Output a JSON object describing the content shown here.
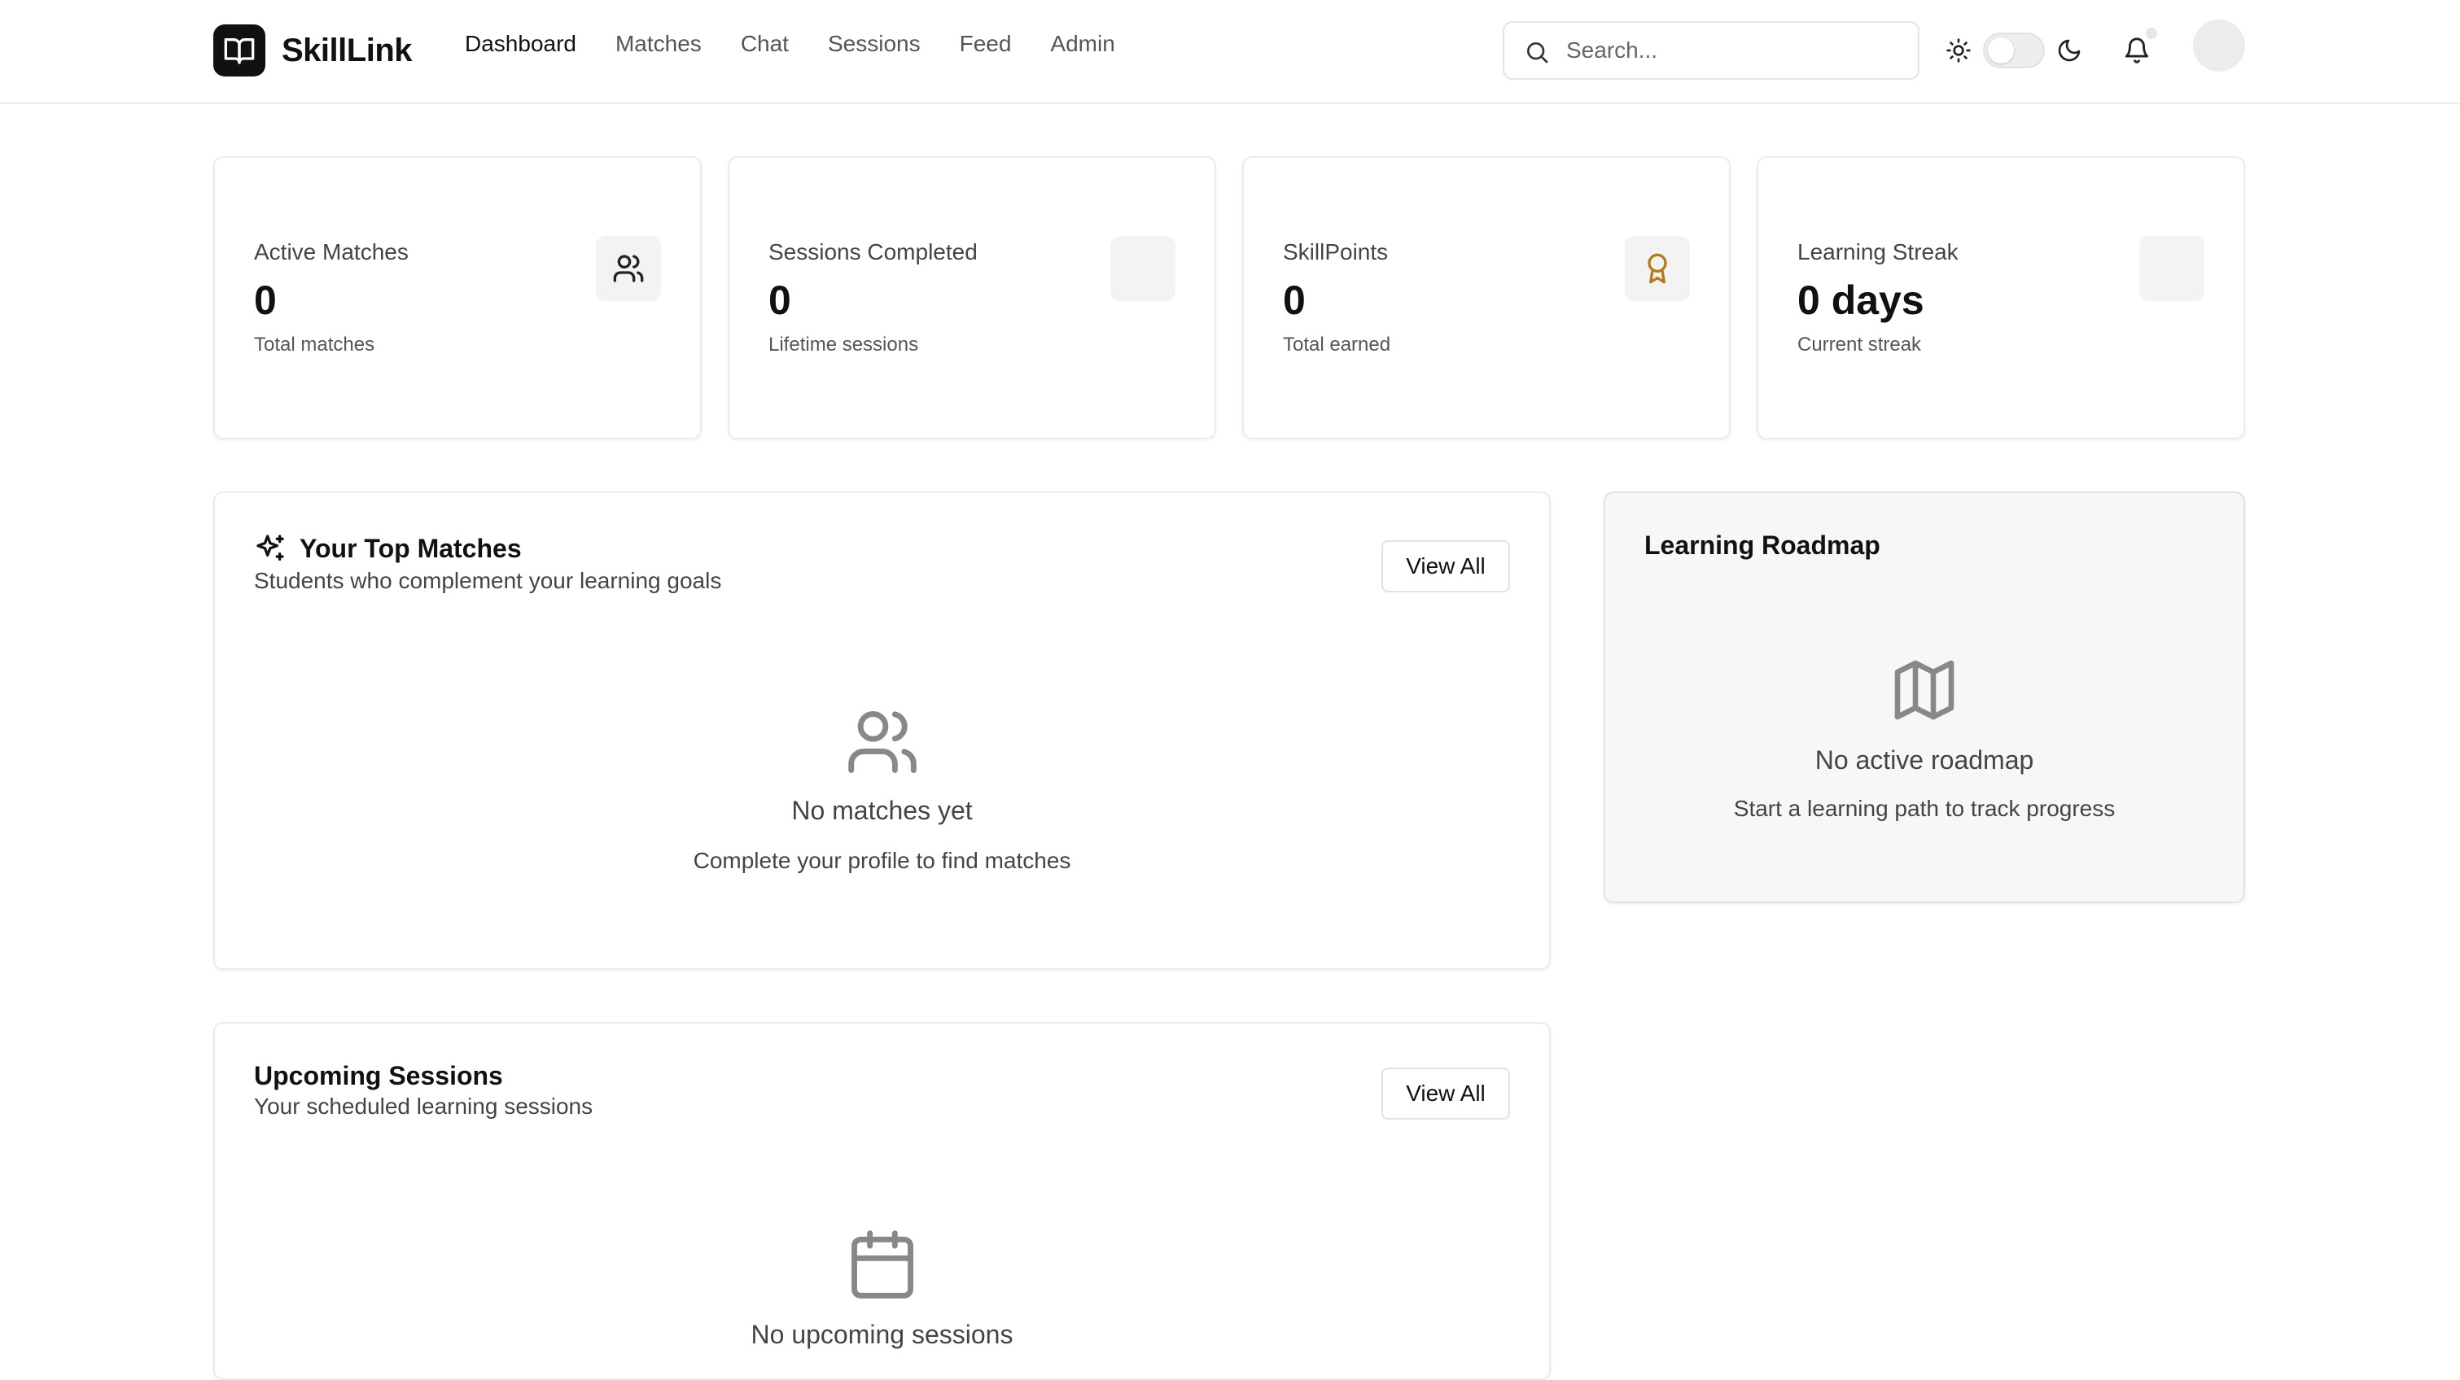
{
  "app": {
    "name": "SkillLink"
  },
  "nav": {
    "items": [
      {
        "label": "Dashboard",
        "active": true
      },
      {
        "label": "Matches"
      },
      {
        "label": "Chat"
      },
      {
        "label": "Sessions"
      },
      {
        "label": "Feed"
      },
      {
        "label": "Admin"
      }
    ]
  },
  "search": {
    "placeholder": "Search..."
  },
  "header_icons": [
    "sun-icon",
    "theme-toggle",
    "moon-icon",
    "bell-icon",
    "avatar"
  ],
  "stats": [
    {
      "label": "Active Matches",
      "value": "0",
      "sub": "Total matches",
      "icon": "users-icon"
    },
    {
      "label": "Sessions Completed",
      "value": "0",
      "sub": "Lifetime sessions",
      "icon": ""
    },
    {
      "label": "SkillPoints",
      "value": "0",
      "sub": "Total earned",
      "icon": "award-icon",
      "icon_color": "#b7791f"
    },
    {
      "label": "Learning Streak",
      "value": "0 days",
      "sub": "Current streak",
      "icon": ""
    }
  ],
  "top_matches": {
    "title": "Your Top Matches",
    "subtitle": "Students who complement your learning goals",
    "view_all": "View All",
    "empty_title": "No matches yet",
    "empty_sub": "Complete your profile to find matches"
  },
  "roadmap": {
    "title": "Learning Roadmap",
    "empty_title": "No active roadmap",
    "empty_sub": "Start a learning path to track progress"
  },
  "upcoming": {
    "title": "Upcoming Sessions",
    "subtitle": "Your scheduled learning sessions",
    "view_all": "View All",
    "empty_title": "No upcoming sessions"
  }
}
